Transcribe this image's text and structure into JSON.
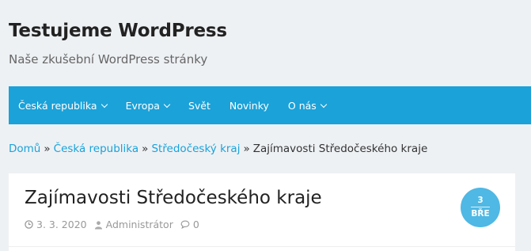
{
  "header": {
    "site_title": "Testujeme WordPress",
    "site_description": "Naše zkušební WordPress stránky"
  },
  "nav": {
    "items": [
      {
        "label": "Česká republika",
        "has_submenu": true
      },
      {
        "label": "Evropa",
        "has_submenu": true
      },
      {
        "label": "Svět",
        "has_submenu": false
      },
      {
        "label": "Novinky",
        "has_submenu": false
      },
      {
        "label": "O nás",
        "has_submenu": true
      }
    ]
  },
  "breadcrumb": {
    "items": [
      {
        "label": "Domů",
        "link": true
      },
      {
        "label": "Česká republika",
        "link": true
      },
      {
        "label": "Středočeský kraj",
        "link": true
      },
      {
        "label": "Zajímavosti Středočeského kraje",
        "link": false
      }
    ],
    "separator": "»"
  },
  "post": {
    "title": "Zajímavosti Středočeského kraje",
    "date": "3. 3. 2020",
    "author": "Administrátor",
    "comments": "0",
    "badge_day": "3",
    "badge_month": "BŘE"
  },
  "colors": {
    "nav_bg": "#1aa2d9",
    "link": "#1aa2d9",
    "badge_bg": "#4fb8e4",
    "page_bg": "#eef1f4"
  },
  "icons": {
    "date": "clock-icon",
    "author": "user-icon",
    "comments": "comment-icon",
    "submenu": "chevron-down-icon"
  }
}
